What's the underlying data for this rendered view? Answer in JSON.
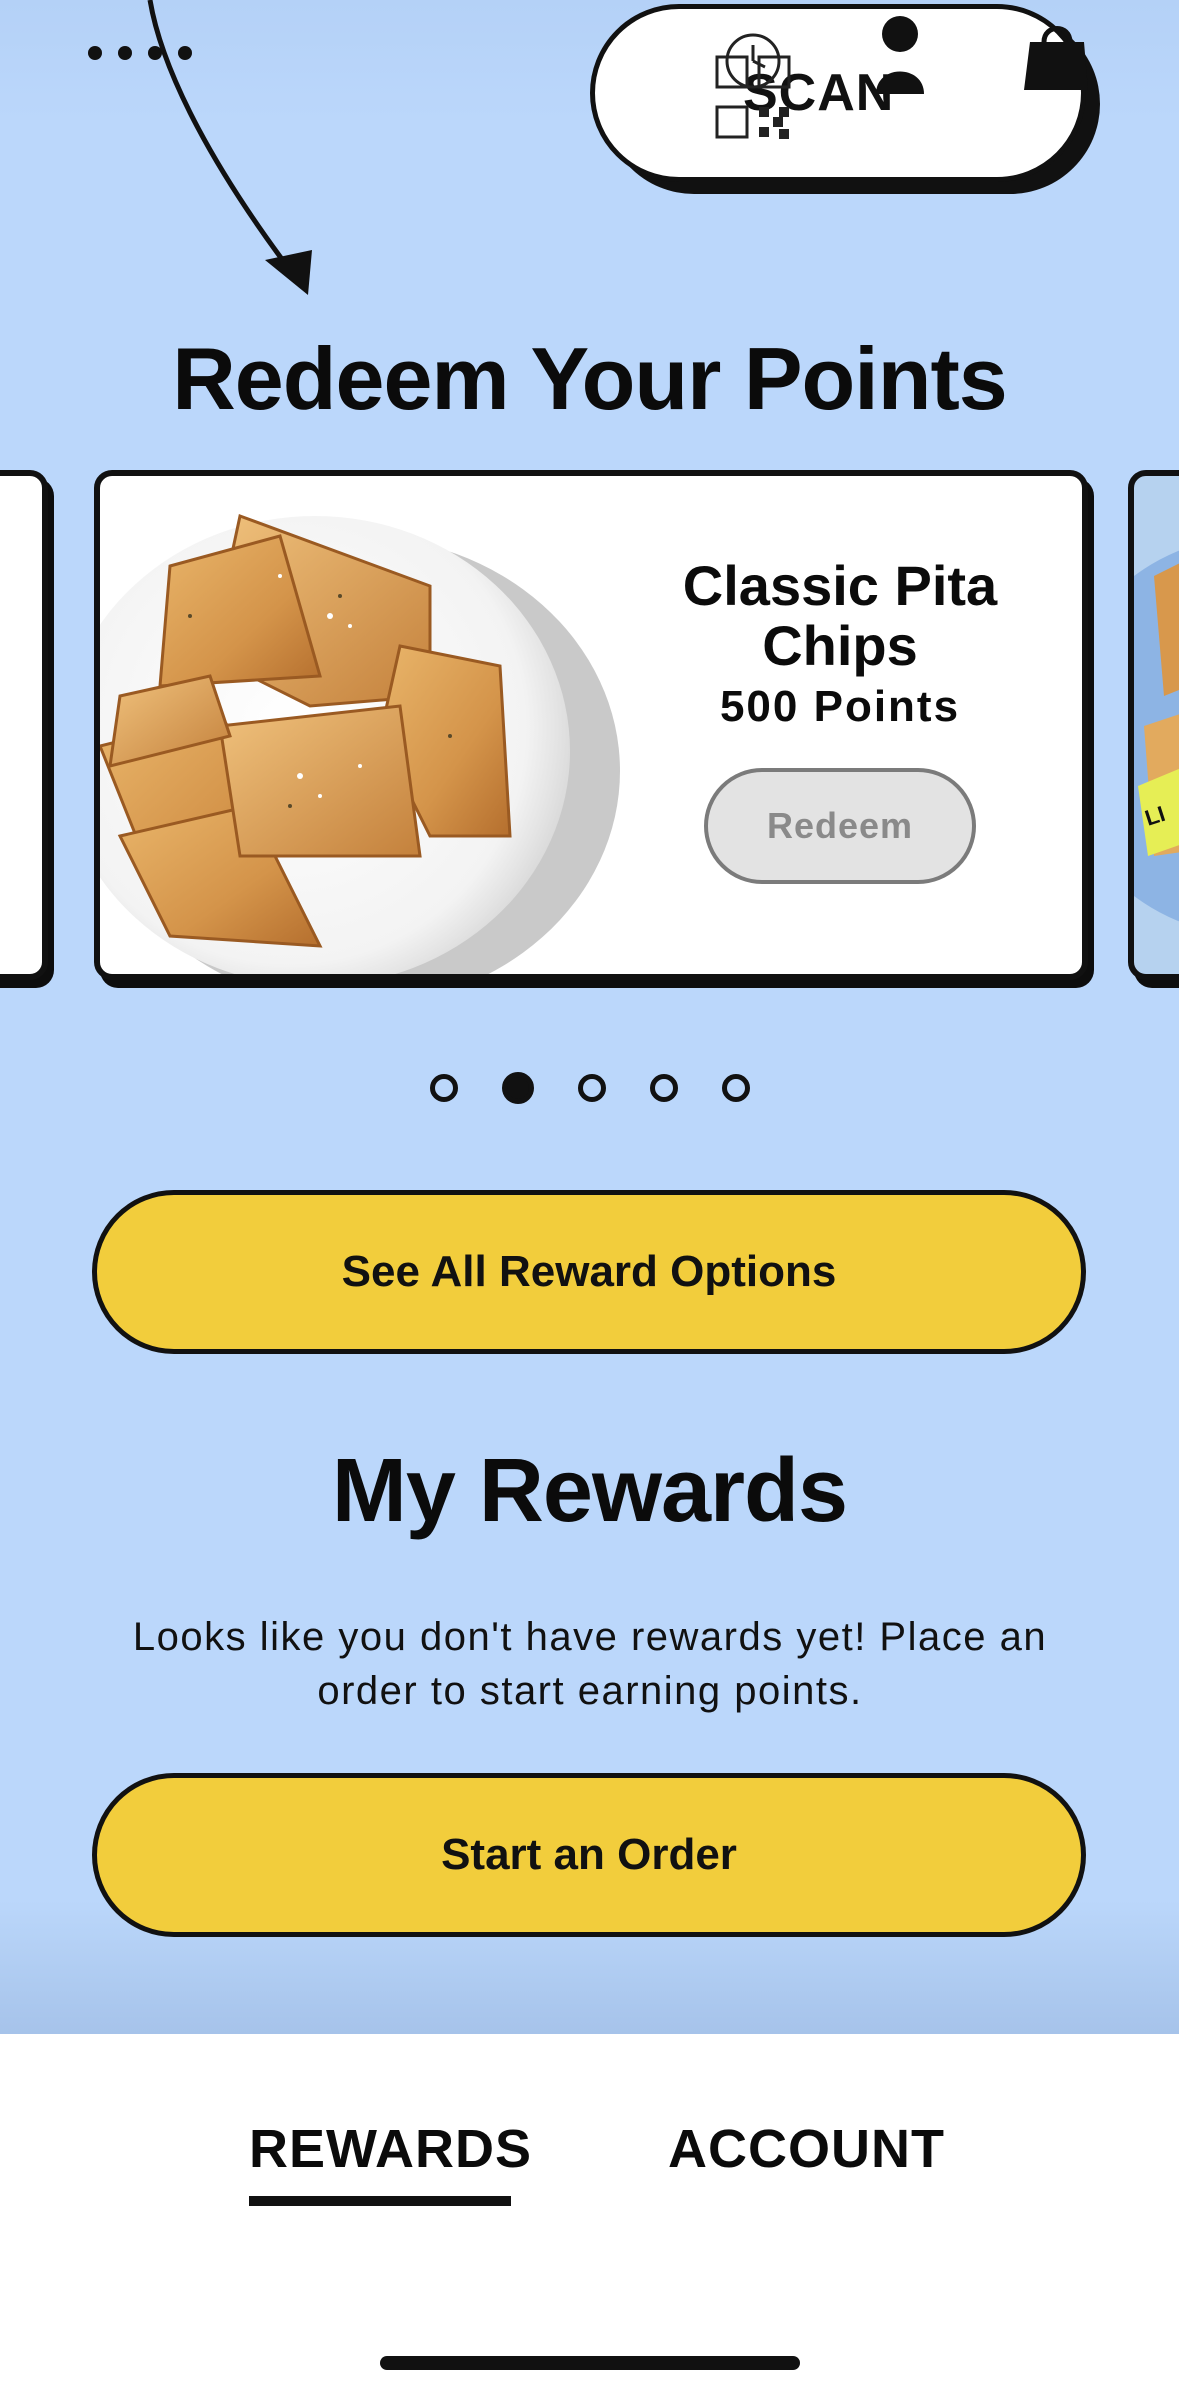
{
  "header": {
    "scan_label": "SCAN",
    "icons": [
      "more-dots-icon",
      "qr-scan-icon",
      "person-icon",
      "bag-icon"
    ]
  },
  "redeem": {
    "title": "Redeem Your Points",
    "card": {
      "name_line1": "Classic Pita",
      "name_line2": "Chips",
      "points": "500 Points",
      "button": "Redeem"
    },
    "peek_tag": "LI",
    "pager": {
      "count": 5,
      "active": 2
    }
  },
  "actions": {
    "see_all": "See All Reward Options",
    "start_order": "Start an Order"
  },
  "my_rewards": {
    "title": "My Rewards",
    "message_line1": "Looks like you don't have rewards yet! Place an",
    "message_line2": "order to start earning points."
  },
  "nav": {
    "tabs": [
      {
        "label": "REWARDS",
        "active": true
      },
      {
        "label": "ACCOUNT",
        "active": false
      }
    ]
  },
  "colors": {
    "background": "#bbd7fb",
    "yellow": "#f2cd3c",
    "ink": "#111111"
  }
}
